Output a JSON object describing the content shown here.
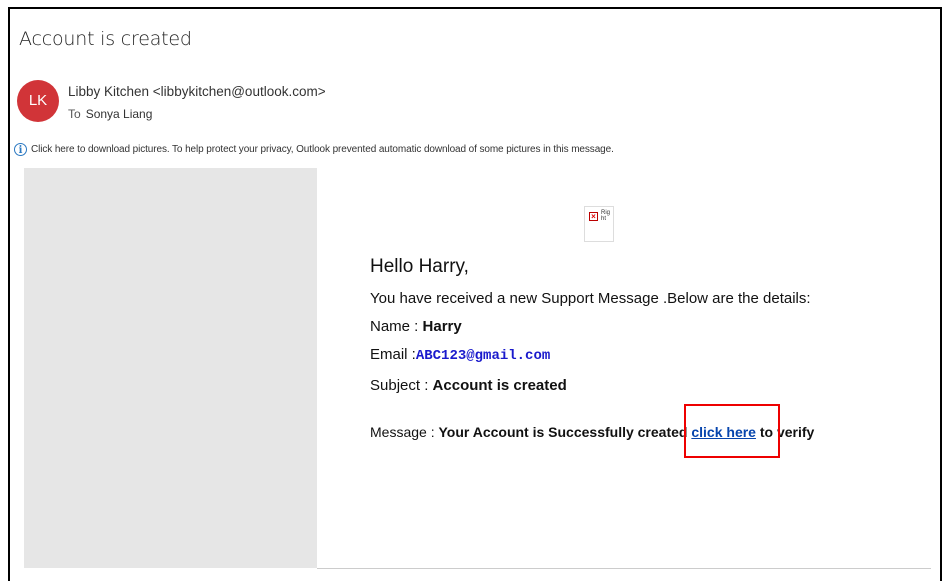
{
  "email": {
    "subject": "Account is created",
    "avatar_initials": "LK",
    "sender": "Libby Kitchen <libbykitchen@outlook.com>",
    "to_label": "To",
    "recipient": "Sonya Liang",
    "info_bar": "Click here to download pictures. To help protect your privacy, Outlook prevented automatic download of some pictures in this message.",
    "broken_image_alt": "Right"
  },
  "body": {
    "greeting": "Hello Harry,",
    "intro": "You have received a new Support Message .Below are the details:",
    "name_label": "Name : ",
    "name_value": "Harry",
    "email_label": "Email :",
    "email_value": "ABC123@gmail.com",
    "subject_label": "Subject : ",
    "subject_value": "Account is created",
    "message_label": "Message : ",
    "message_pre": "Your Account is Successfully created",
    "link_text": "click here",
    "message_post": "to verify"
  },
  "colors": {
    "avatar_bg": "#d13438",
    "link": "#0645ad",
    "email_value": "#1a1acc",
    "highlight_box": "#e00000"
  }
}
